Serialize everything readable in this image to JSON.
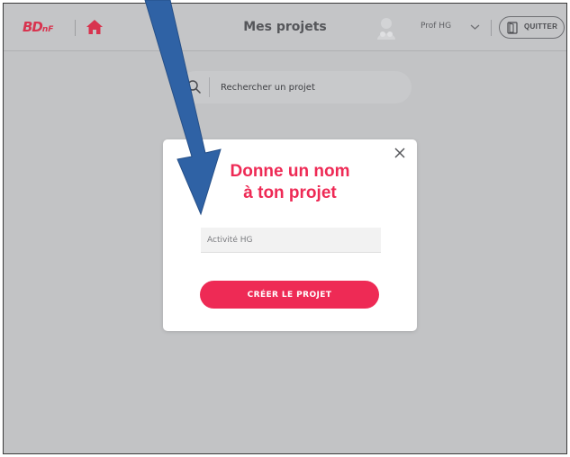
{
  "header": {
    "logo": "BD",
    "logo_suffix": "nF",
    "title": "Mes projets",
    "user_name": "Prof HG",
    "quit_label": "QUITTER"
  },
  "search": {
    "placeholder": "Rechercher un projet"
  },
  "modal": {
    "title_line1": "Donne un nom",
    "title_line2": "à ton projet",
    "input_value": "Activité HG",
    "create_label": "CRÉER LE PROJET"
  },
  "icons": {
    "home": "home-icon",
    "avatar": "user-avatar-icon",
    "chevron": "chevron-down-icon",
    "quit": "door-exit-icon",
    "search": "search-icon",
    "close": "close-icon",
    "annotation": "arrow-annotation"
  },
  "colors": {
    "accent": "#ee2a55",
    "logo": "#d8344f",
    "overlay": "#c2c3c5",
    "annotation_arrow": "#2f62a5"
  }
}
